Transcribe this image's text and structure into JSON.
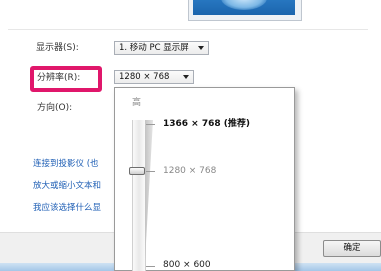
{
  "display": {
    "label": "显示器(S):",
    "value": "1. 移动 PC 显示屏"
  },
  "resolution": {
    "label": "分辨率(R):",
    "value": "1280 × 768"
  },
  "orientation": {
    "label": "方向(O):"
  },
  "links": {
    "projector": "连接到投影仪 (也",
    "text_size": "放大或缩小文本和",
    "choose": "我应该选择什么显"
  },
  "dropdown": {
    "high": "高",
    "recommended": "1366 × 768 (推荐)",
    "current": "1280 × 768",
    "low": "800 × 600"
  },
  "buttons": {
    "ok": "确定"
  },
  "colors": {
    "highlight": "#e0176b",
    "link": "#1f5fb5"
  }
}
